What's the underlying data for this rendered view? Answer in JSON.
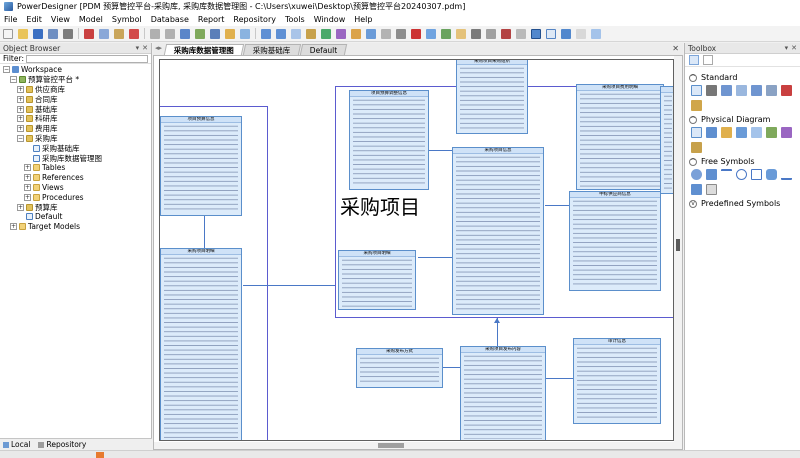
{
  "window": {
    "title": "PowerDesigner [PDM 预算管控平台-采购库, 采购库数据管理图 - C:\\Users\\xuwei\\Desktop\\预算管控平台20240307.pdm]"
  },
  "menu": [
    "File",
    "Edit",
    "View",
    "Model",
    "Symbol",
    "Database",
    "Report",
    "Repository",
    "Tools",
    "Window",
    "Help"
  ],
  "object_browser": {
    "title": "Object Browser",
    "filter_label": "Filter:",
    "tree": [
      {
        "label": "Workspace",
        "level": 0,
        "exp": "minus",
        "icon": "workspace-icon"
      },
      {
        "label": "预算管控平台 *",
        "level": 1,
        "exp": "minus",
        "icon": "model-icon"
      },
      {
        "label": "供应商库",
        "level": 2,
        "exp": "plus",
        "icon": "package-icon"
      },
      {
        "label": "合同库",
        "level": 2,
        "exp": "plus",
        "icon": "package-icon"
      },
      {
        "label": "基础库",
        "level": 2,
        "exp": "plus",
        "icon": "package-icon"
      },
      {
        "label": "科研库",
        "level": 2,
        "exp": "plus",
        "icon": "package-icon"
      },
      {
        "label": "费用库",
        "level": 2,
        "exp": "plus",
        "icon": "package-icon"
      },
      {
        "label": "采购库",
        "level": 2,
        "exp": "minus",
        "icon": "package-icon"
      },
      {
        "label": "采购基础库",
        "level": 3,
        "exp": "none",
        "icon": "diagram-icon"
      },
      {
        "label": "采购库数据管理图",
        "level": 3,
        "exp": "none",
        "icon": "diagram-icon"
      },
      {
        "label": "Tables",
        "level": 3,
        "exp": "plus",
        "icon": "folder-icon"
      },
      {
        "label": "References",
        "level": 3,
        "exp": "plus",
        "icon": "folder-icon"
      },
      {
        "label": "Views",
        "level": 3,
        "exp": "plus",
        "icon": "folder-icon"
      },
      {
        "label": "Procedures",
        "level": 3,
        "exp": "plus",
        "icon": "folder-icon"
      },
      {
        "label": "预算库",
        "level": 2,
        "exp": "plus",
        "icon": "package-icon"
      },
      {
        "label": "Default",
        "level": 2,
        "exp": "none",
        "icon": "diagram-icon"
      },
      {
        "label": "Target Models",
        "level": 1,
        "exp": "plus",
        "icon": "folder-icon"
      }
    ],
    "tabs": [
      "Local",
      "Repository"
    ]
  },
  "diagram_tabs": [
    "采购库数据管理图",
    "采购基础库",
    "Default"
  ],
  "canvas": {
    "big_label": "采购项目",
    "entities": [
      "项目预算信息",
      "采购项目信息",
      "采购项目明细",
      "中标供应商信息",
      "项目预算调整信息",
      "采购项目采购组织",
      "采购项目费用明细",
      "采购项目发布内容",
      "采购项目调整记录",
      "审计信息",
      "采购发布方式"
    ]
  },
  "toolbox": {
    "title": "Toolbox",
    "sections": [
      "Standard",
      "Physical Diagram",
      "Free Symbols",
      "Predefined Symbols"
    ]
  }
}
